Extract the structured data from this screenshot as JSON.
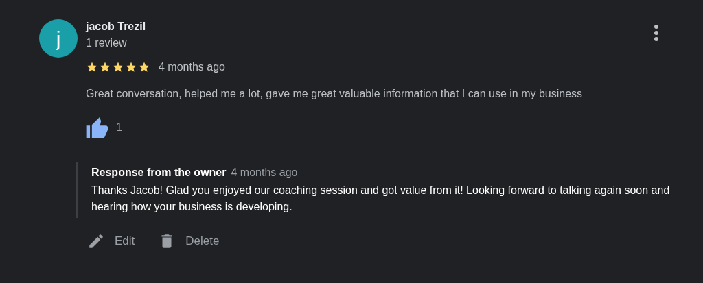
{
  "review": {
    "avatar_letter": "j",
    "author": "jacob Trezil",
    "review_count": "1 review",
    "stars": 5,
    "time": "4 months ago",
    "text": "Great conversation, helped me a lot, gave me great valuable information that I can use in my business",
    "likes": "1"
  },
  "owner_response": {
    "title": "Response from the owner",
    "time": "4 months ago",
    "text": "Thanks Jacob! Glad you enjoyed our coaching session and got value from it! Looking forward to talking again soon and hearing how your business is developing."
  },
  "actions": [
    {
      "kind": "edit",
      "label": "Edit"
    },
    {
      "kind": "delete",
      "label": "Delete"
    }
  ]
}
